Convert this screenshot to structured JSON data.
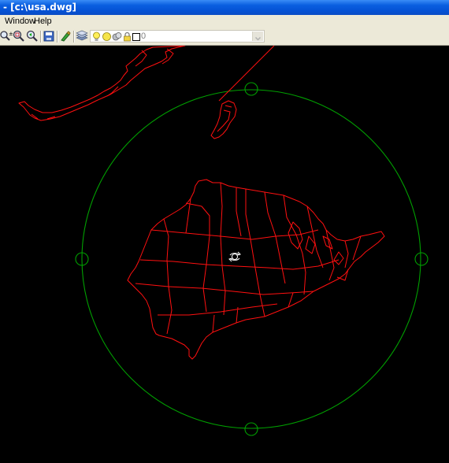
{
  "window": {
    "title": "- [c:\\usa.dwg]"
  },
  "menu": {
    "items": [
      "Window",
      "Help"
    ]
  },
  "toolbar": {
    "layer_value": "0",
    "icons": [
      "zoom-realtime-icon",
      "zoom-window-icon",
      "zoom-previous-icon",
      "save-icon",
      "match-properties-icon",
      "layers-icon",
      "bulb-icon",
      "sun-icon",
      "freeze-icon",
      "lock-icon",
      "layer-color-icon",
      "dropdown-arrow-icon"
    ]
  },
  "colors": {
    "drawing": "#ff1010",
    "orbit": "#00a000",
    "titlebar": "#0a5fe0",
    "chrome": "#ece9d8"
  }
}
